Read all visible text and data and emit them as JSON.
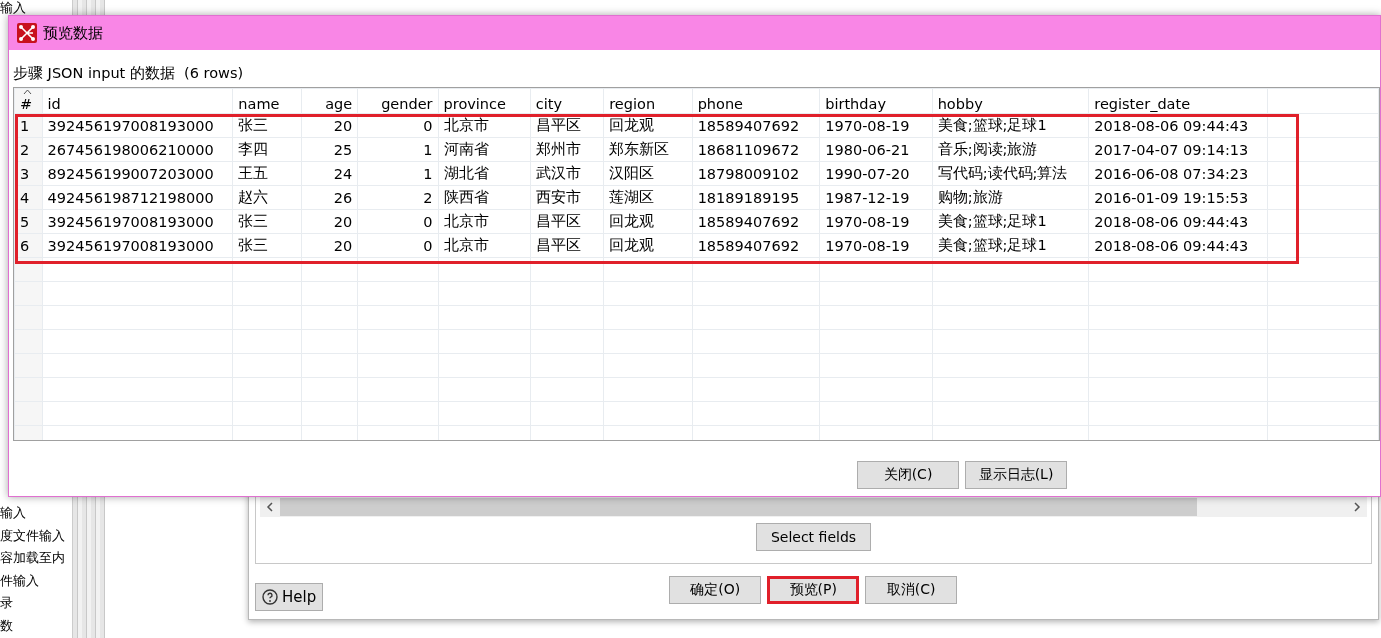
{
  "sidebar": {
    "items": [
      "输入",
      "输入",
      "度文件输入",
      "容加载至内",
      "件输入",
      "录",
      "数"
    ]
  },
  "step_dialog": {
    "select_fields": "Select fields",
    "help": "Help",
    "buttons": [
      {
        "label": "确定(O)",
        "highlighted": false
      },
      {
        "label": "预览(P)",
        "highlighted": true
      },
      {
        "label": "取消(C)",
        "highlighted": false
      }
    ]
  },
  "preview_dialog": {
    "title": "预览数据",
    "caption": "步骤 JSON input 的数据  (6 rows)",
    "table": {
      "highlighted": true,
      "columns": [
        {
          "label": "#",
          "kind": "text"
        },
        {
          "label": "id",
          "kind": "text"
        },
        {
          "label": "name",
          "kind": "text"
        },
        {
          "label": "age",
          "kind": "numeric"
        },
        {
          "label": "gender",
          "kind": "numeric"
        },
        {
          "label": "province",
          "kind": "text"
        },
        {
          "label": "city",
          "kind": "text"
        },
        {
          "label": "region",
          "kind": "text"
        },
        {
          "label": "phone",
          "kind": "text"
        },
        {
          "label": "birthday",
          "kind": "text"
        },
        {
          "label": "hobby",
          "kind": "text"
        },
        {
          "label": "register_date",
          "kind": "text"
        }
      ],
      "rows": [
        [
          "1",
          "392456197008193000",
          "张三",
          "20",
          "0",
          "北京市",
          "昌平区",
          "回龙观",
          "18589407692",
          "1970-08-19",
          "美食;篮球;足球1",
          "2018-08-06 09:44:43"
        ],
        [
          "2",
          "267456198006210000",
          "李四",
          "25",
          "1",
          "河南省",
          "郑州市",
          "郑东新区",
          "18681109672",
          "1980-06-21",
          "音乐;阅读;旅游",
          "2017-04-07 09:14:13"
        ],
        [
          "3",
          "892456199007203000",
          "王五",
          "24",
          "1",
          "湖北省",
          "武汉市",
          "汉阳区",
          "18798009102",
          "1990-07-20",
          "写代码;读代码;算法",
          "2016-06-08 07:34:23"
        ],
        [
          "4",
          "492456198712198000",
          "赵六",
          "26",
          "2",
          "陕西省",
          "西安市",
          "莲湖区",
          "18189189195",
          "1987-12-19",
          "购物;旅游",
          "2016-01-09 19:15:53"
        ],
        [
          "5",
          "392456197008193000",
          "张三",
          "20",
          "0",
          "北京市",
          "昌平区",
          "回龙观",
          "18589407692",
          "1970-08-19",
          "美食;篮球;足球1",
          "2018-08-06 09:44:43"
        ],
        [
          "6",
          "392456197008193000",
          "张三",
          "20",
          "0",
          "北京市",
          "昌平区",
          "回龙观",
          "18589407692",
          "1970-08-19",
          "美食;篮球;足球1",
          "2018-08-06 09:44:43"
        ]
      ]
    },
    "buttons": [
      {
        "label": "关闭(C)"
      },
      {
        "label": "显示日志(L)"
      }
    ]
  }
}
